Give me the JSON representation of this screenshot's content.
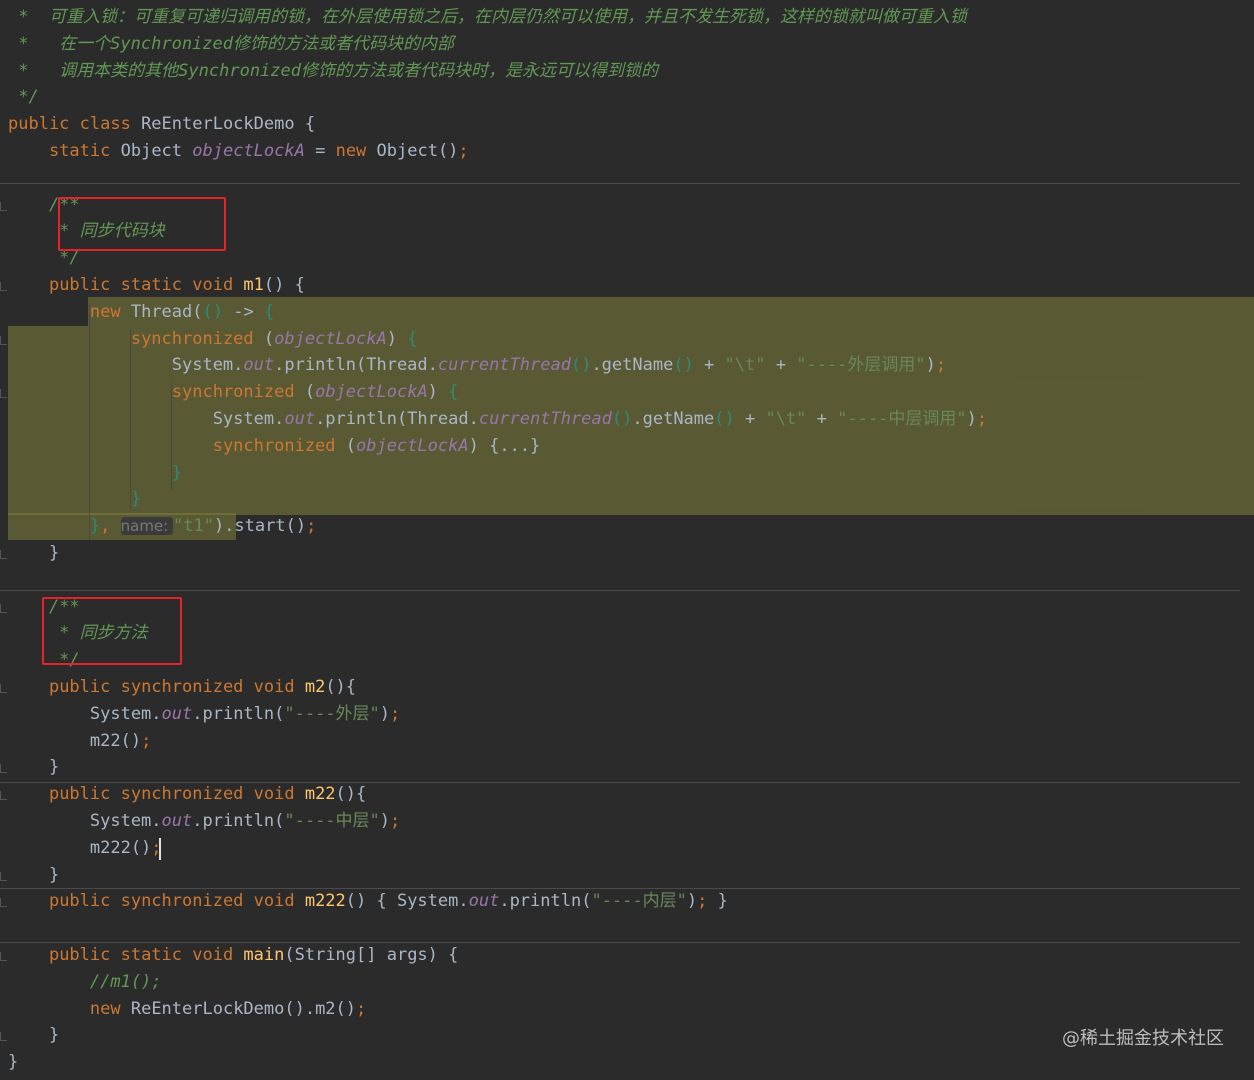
{
  "colors": {
    "keyword": "#cc7832",
    "default": "#a9b7c6",
    "comment": "#629755",
    "doc_comment": "#629755",
    "static_field": "#9876aa",
    "string": "#6a8759",
    "method_decl": "#ffc66d",
    "param_hint": "#787878",
    "brace_match": "#2d8a7a",
    "highlight": "#7d7c3a",
    "red_box": "#e5232a"
  },
  "code": {
    "lines": [
      [
        {
          "c": "doc_comment",
          "t": " *  可重入锁：可重复可递归调用的锁，在外层使用锁之后，在内层仍然可以使用，并且不发生死锁，这样的锁就叫做可重入锁"
        }
      ],
      [
        {
          "c": "doc_comment",
          "t": " *   在一个Synchronized修饰的方法或者代码块的内部"
        }
      ],
      [
        {
          "c": "doc_comment",
          "t": " *   调用本类的其他Synchronized修饰的方法或者代码块时，是永远可以得到锁的"
        }
      ],
      [
        {
          "c": "doc_comment",
          "t": " */"
        }
      ],
      [
        {
          "c": "keyword",
          "t": "public class "
        },
        {
          "c": "default",
          "t": "ReEnterLockDemo {"
        }
      ],
      [
        {
          "c": "default",
          "t": "    "
        },
        {
          "c": "keyword",
          "t": "static "
        },
        {
          "c": "default",
          "t": "Object "
        },
        {
          "c": "static_field",
          "t": "objectLockA"
        },
        {
          "c": "default",
          "t": " = "
        },
        {
          "c": "keyword",
          "t": "new "
        },
        {
          "c": "default",
          "t": "Object()"
        },
        {
          "c": "keyword",
          "t": ";"
        }
      ],
      [],
      [
        {
          "c": "doc_comment",
          "t": "    /**"
        }
      ],
      [
        {
          "c": "doc_comment",
          "t": "     * 同步代码块"
        }
      ],
      [
        {
          "c": "doc_comment",
          "t": "     */"
        }
      ],
      [
        {
          "c": "default",
          "t": "    "
        },
        {
          "c": "keyword",
          "t": "public static void "
        },
        {
          "c": "method_decl",
          "t": "m1"
        },
        {
          "c": "default",
          "t": "() {"
        }
      ],
      [
        {
          "c": "default",
          "t": "        "
        },
        {
          "c": "keyword",
          "t": "new "
        },
        {
          "c": "default",
          "t": "Thread("
        },
        {
          "c": "brace_match",
          "t": "()"
        },
        {
          "c": "default",
          "t": " -> "
        },
        {
          "c": "brace_match",
          "t": "{"
        }
      ],
      [
        {
          "c": "default",
          "t": "            "
        },
        {
          "c": "keyword",
          "t": "synchronized "
        },
        {
          "c": "default",
          "t": "("
        },
        {
          "c": "static_field",
          "t": "objectLockA"
        },
        {
          "c": "default",
          "t": ") "
        },
        {
          "c": "brace_match",
          "t": "{"
        }
      ],
      [
        {
          "c": "default",
          "t": "                System."
        },
        {
          "c": "static_field",
          "t": "out"
        },
        {
          "c": "default",
          "t": ".println(Thread."
        },
        {
          "c": "static_field",
          "t": "currentThread"
        },
        {
          "c": "brace_match",
          "t": "()"
        },
        {
          "c": "default",
          "t": ".getName"
        },
        {
          "c": "brace_match",
          "t": "()"
        },
        {
          "c": "default",
          "t": " + "
        },
        {
          "c": "string",
          "t": "\"\\t\""
        },
        {
          "c": "default",
          "t": " + "
        },
        {
          "c": "string",
          "t": "\"----外层调用\""
        },
        {
          "c": "default",
          "t": ")"
        },
        {
          "c": "keyword",
          "t": ";"
        }
      ],
      [
        {
          "c": "default",
          "t": "                "
        },
        {
          "c": "keyword",
          "t": "synchronized "
        },
        {
          "c": "default",
          "t": "("
        },
        {
          "c": "static_field",
          "t": "objectLockA"
        },
        {
          "c": "default",
          "t": ") "
        },
        {
          "c": "brace_match",
          "t": "{"
        }
      ],
      [
        {
          "c": "default",
          "t": "                    System."
        },
        {
          "c": "static_field",
          "t": "out"
        },
        {
          "c": "default",
          "t": ".println(Thread."
        },
        {
          "c": "static_field",
          "t": "currentThread"
        },
        {
          "c": "brace_match",
          "t": "()"
        },
        {
          "c": "default",
          "t": ".getName"
        },
        {
          "c": "brace_match",
          "t": "()"
        },
        {
          "c": "default",
          "t": " + "
        },
        {
          "c": "string",
          "t": "\"\\t\""
        },
        {
          "c": "default",
          "t": " + "
        },
        {
          "c": "string",
          "t": "\"----中层调用\""
        },
        {
          "c": "default",
          "t": ")"
        },
        {
          "c": "keyword",
          "t": ";"
        }
      ],
      [
        {
          "c": "default",
          "t": "                    "
        },
        {
          "c": "keyword",
          "t": "synchronized "
        },
        {
          "c": "default",
          "t": "("
        },
        {
          "c": "static_field",
          "t": "objectLockA"
        },
        {
          "c": "default",
          "t": ") "
        },
        {
          "c": "default",
          "t": "{...}"
        }
      ],
      [
        {
          "c": "brace_match",
          "t": "                }"
        }
      ],
      [
        {
          "c": "brace_match",
          "t": "            }"
        }
      ],
      [
        {
          "c": "default",
          "t": "        "
        },
        {
          "c": "brace_match",
          "t": "}"
        },
        {
          "c": "keyword",
          "t": ", "
        },
        {
          "c": "param_hint",
          "t": "name: "
        },
        {
          "c": "string",
          "t": "\"t1\""
        },
        {
          "c": "default",
          "t": ").start()"
        },
        {
          "c": "keyword",
          "t": ";"
        }
      ],
      [
        {
          "c": "default",
          "t": "    }"
        }
      ],
      [],
      [
        {
          "c": "doc_comment",
          "t": "    /**"
        }
      ],
      [
        {
          "c": "doc_comment",
          "t": "     * 同步方法"
        }
      ],
      [
        {
          "c": "doc_comment",
          "t": "     */"
        }
      ],
      [
        {
          "c": "default",
          "t": "    "
        },
        {
          "c": "keyword",
          "t": "public synchronized void "
        },
        {
          "c": "method_decl",
          "t": "m2"
        },
        {
          "c": "default",
          "t": "(){"
        }
      ],
      [
        {
          "c": "default",
          "t": "        System."
        },
        {
          "c": "static_field",
          "t": "out"
        },
        {
          "c": "default",
          "t": ".println("
        },
        {
          "c": "string",
          "t": "\"----外层\""
        },
        {
          "c": "default",
          "t": ")"
        },
        {
          "c": "keyword",
          "t": ";"
        }
      ],
      [
        {
          "c": "default",
          "t": "        m22()"
        },
        {
          "c": "keyword",
          "t": ";"
        }
      ],
      [
        {
          "c": "default",
          "t": "    }"
        }
      ],
      [
        {
          "c": "default",
          "t": "    "
        },
        {
          "c": "keyword",
          "t": "public synchronized void "
        },
        {
          "c": "method_decl",
          "t": "m22"
        },
        {
          "c": "default",
          "t": "(){"
        }
      ],
      [
        {
          "c": "default",
          "t": "        System."
        },
        {
          "c": "static_field",
          "t": "out"
        },
        {
          "c": "default",
          "t": ".println("
        },
        {
          "c": "string",
          "t": "\"----中层\""
        },
        {
          "c": "default",
          "t": ")"
        },
        {
          "c": "keyword",
          "t": ";"
        }
      ],
      [
        {
          "c": "default",
          "t": "        m222()"
        },
        {
          "c": "keyword",
          "t": ";"
        }
      ],
      [
        {
          "c": "default",
          "t": "    }"
        }
      ],
      [
        {
          "c": "default",
          "t": "    "
        },
        {
          "c": "keyword",
          "t": "public synchronized void "
        },
        {
          "c": "method_decl",
          "t": "m222"
        },
        {
          "c": "default",
          "t": "() { System."
        },
        {
          "c": "static_field",
          "t": "out"
        },
        {
          "c": "default",
          "t": ".println("
        },
        {
          "c": "string",
          "t": "\"----内层\""
        },
        {
          "c": "default",
          "t": ")"
        },
        {
          "c": "keyword",
          "t": ";"
        },
        {
          "c": "default",
          "t": " }"
        }
      ],
      [],
      [
        {
          "c": "default",
          "t": "    "
        },
        {
          "c": "keyword",
          "t": "public static void "
        },
        {
          "c": "method_decl",
          "t": "main"
        },
        {
          "c": "default",
          "t": "(String[] args) {"
        }
      ],
      [
        {
          "c": "comment",
          "t": "        //m1();"
        }
      ],
      [
        {
          "c": "default",
          "t": "        "
        },
        {
          "c": "keyword",
          "t": "new "
        },
        {
          "c": "default",
          "t": "ReEnterLockDemo().m2()"
        },
        {
          "c": "keyword",
          "t": ";"
        }
      ],
      [
        {
          "c": "default",
          "t": "    }"
        }
      ],
      [
        {
          "c": "default",
          "t": "}"
        }
      ]
    ]
  },
  "watermark": "@稀土掘金技术社区"
}
